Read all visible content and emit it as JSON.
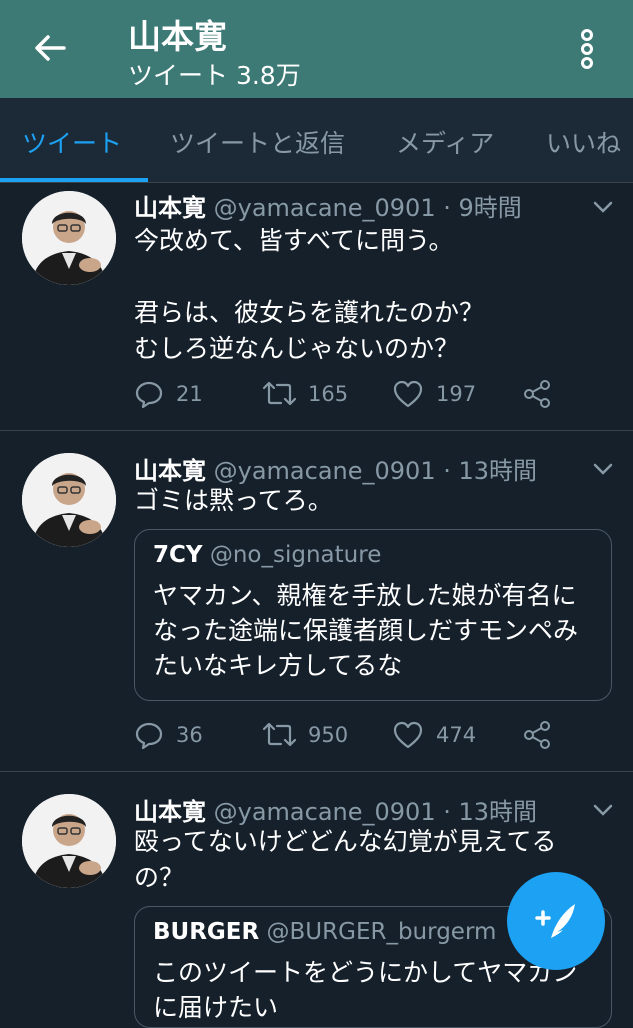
{
  "header": {
    "name": "山本寛",
    "tweet_count_label": "ツイート 3.8万"
  },
  "tabs": [
    {
      "label": "ツイート"
    },
    {
      "label": "ツイートと返信"
    },
    {
      "label": "メディア"
    },
    {
      "label": "いいね"
    }
  ],
  "tweets": [
    {
      "name": "山本寛",
      "handle": "@yamacane_0901",
      "time": "· 9時間",
      "text": "今改めて、皆すべてに問う。\n\n君らは、彼女らを護れたのか？\nむしろ逆なんじゃないのか？",
      "replies": "21",
      "retweets": "165",
      "likes": "197"
    },
    {
      "name": "山本寛",
      "handle": "@yamacane_0901",
      "time": "· 13時間",
      "text": "ゴミは黙ってろ。",
      "quote": {
        "name": "7CY",
        "handle": "@no_signature",
        "text": "ヤマカン、親権を手放した娘が有名になった途端に保護者顔しだすモンペみたいなキレ方してるな"
      },
      "replies": "36",
      "retweets": "950",
      "likes": "474"
    },
    {
      "name": "山本寛",
      "handle": "@yamacane_0901",
      "time": "· 13時間",
      "text": "殴ってないけどどんな幻覚が見えてるの？",
      "quote": {
        "name": "BURGER",
        "handle": "@BURGER_burgerm",
        "text": "このツイートをどうにかしてヤマカンに届けたい"
      }
    }
  ],
  "icons": {
    "back": "arrow-left-icon",
    "more": "more-vertical-icon",
    "reply": "reply-icon",
    "retweet": "retweet-icon",
    "like": "heart-icon",
    "share": "share-icon",
    "compose": "compose-tweet-icon"
  },
  "colors": {
    "header_bg": "#3d7a76",
    "background": "#15202b",
    "accent": "#1da1f2",
    "muted": "#8899a6"
  }
}
